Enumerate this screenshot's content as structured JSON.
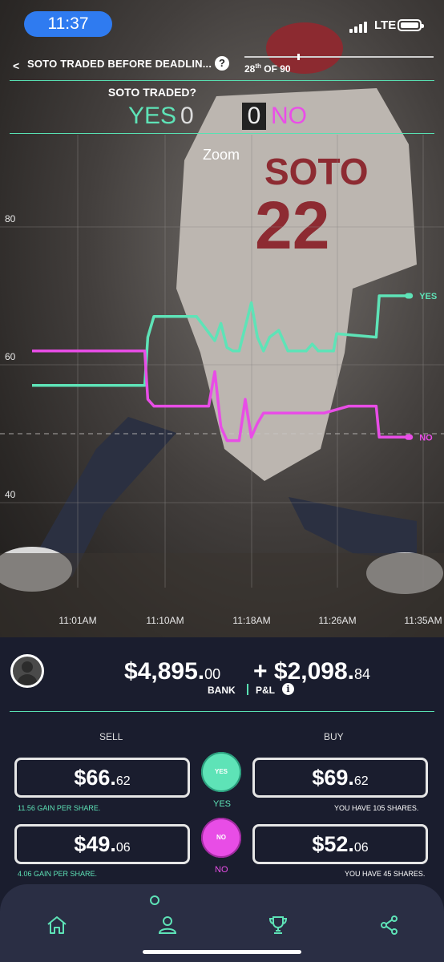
{
  "status_bar": {
    "time": "11:37",
    "network": "LTE"
  },
  "nav": {
    "back_glyph": "<",
    "title": "SOTO TRADED BEFORE DEADLIN...",
    "help_glyph": "?",
    "rank_num": "28",
    "rank_sup": "th",
    "rank_rest": " OF 90",
    "progress_fraction": 0.28
  },
  "question": {
    "title": "SOTO TRADED?",
    "yes_label": "YES",
    "yes_count": "0",
    "no_count": "0",
    "no_label": "NO"
  },
  "chart": {
    "zoom_label": "Zoom"
  },
  "chart_data": {
    "type": "line",
    "title": "",
    "xlabel": "",
    "ylabel": "",
    "y_ticks": [
      "80",
      "60",
      "40"
    ],
    "x_ticks": [
      "11:01AM",
      "11:10AM",
      "11:18AM",
      "11:26AM",
      "11:35AM"
    ],
    "ylim": [
      32,
      88
    ],
    "reference_line": 50,
    "grid": true,
    "series": [
      {
        "name": "YES",
        "color": "#5ee3b7",
        "points": [
          [
            0,
            57
          ],
          [
            18.5,
            57
          ],
          [
            19,
            64
          ],
          [
            20,
            67
          ],
          [
            27,
            67
          ],
          [
            30,
            63.5
          ],
          [
            31,
            66
          ],
          [
            32,
            62.5
          ],
          [
            33,
            62
          ],
          [
            34,
            62
          ],
          [
            36,
            69
          ],
          [
            37,
            64
          ],
          [
            38,
            62
          ],
          [
            39,
            64
          ],
          [
            40.5,
            65
          ],
          [
            42,
            62
          ],
          [
            43,
            62
          ],
          [
            44,
            62
          ],
          [
            45,
            62
          ],
          [
            46,
            63
          ],
          [
            47,
            62
          ],
          [
            48,
            62
          ],
          [
            49,
            62
          ],
          [
            49.5,
            62
          ],
          [
            50,
            64.5
          ],
          [
            56.5,
            64
          ],
          [
            57,
            70
          ],
          [
            58,
            70
          ],
          [
            62,
            70
          ]
        ]
      },
      {
        "name": "NO",
        "color": "#e84de6",
        "points": [
          [
            0,
            62
          ],
          [
            18.5,
            62
          ],
          [
            19,
            55
          ],
          [
            20,
            54
          ],
          [
            27,
            54
          ],
          [
            29,
            54
          ],
          [
            30,
            59
          ],
          [
            31,
            51
          ],
          [
            32,
            49
          ],
          [
            33,
            49
          ],
          [
            34,
            49
          ],
          [
            35,
            55
          ],
          [
            36,
            49.5
          ],
          [
            37,
            51.5
          ],
          [
            38,
            53
          ],
          [
            40,
            53
          ],
          [
            42,
            53
          ],
          [
            45,
            53
          ],
          [
            48,
            53
          ],
          [
            52,
            54
          ],
          [
            56.5,
            54
          ],
          [
            57,
            49.5
          ],
          [
            58,
            49.5
          ],
          [
            62,
            49.5
          ]
        ]
      }
    ]
  },
  "account": {
    "currency": "$",
    "bank_main": "4,895.",
    "bank_cents": "00",
    "pl_sign": "+",
    "pl_main": "2,098.",
    "pl_cents": "84",
    "bank_label": "BANK",
    "pl_label": "P&L",
    "info_glyph": "i"
  },
  "trade": {
    "sell_label": "SELL",
    "buy_label": "BUY",
    "yes": {
      "sell_main": "66.",
      "sell_cents": "62",
      "buy_main": "69.",
      "buy_cents": "62",
      "gain": "11.56 GAIN PER SHARE.",
      "shares": "YOU HAVE 105 SHARES.",
      "bubble": "YES",
      "label": "YES"
    },
    "no": {
      "sell_main": "49.",
      "sell_cents": "06",
      "buy_main": "52.",
      "buy_cents": "06",
      "gain": "4.06 GAIN PER SHARE.",
      "shares": "YOU HAVE 45 SHARES.",
      "bubble": "NO",
      "label": "NO"
    }
  },
  "colors": {
    "yes": "#5ee3b7",
    "no": "#e84de6",
    "background": "#1a1d2e",
    "tabbar": "#2a2e44"
  },
  "tabs": [
    "home-icon",
    "user-icon",
    "trophy-icon",
    "share-icon"
  ]
}
